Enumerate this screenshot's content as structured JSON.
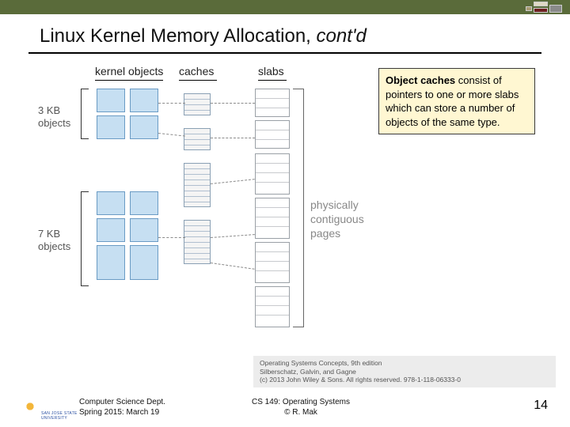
{
  "title": {
    "main": "Linux Kernel Memory Allocation, ",
    "italic": "cont'd"
  },
  "diagram": {
    "headers": {
      "kernel_objects": "kernel objects",
      "caches": "caches",
      "slabs": "slabs"
    },
    "left_labels": {
      "three_kb": "3 KB\nobjects",
      "seven_kb": "7 KB\nobjects"
    },
    "phys_label": "physically\ncontiguous\npages"
  },
  "callout": {
    "bold": "Object caches",
    "rest": " consist of pointers to one or more slabs which can store a number of objects of the same type."
  },
  "reference": {
    "line1": "Operating Systems Concepts, 9th edition",
    "line2": "Silberschatz, Galvin, and Gagne",
    "line3": "(c) 2013 John Wiley & Sons. All rights reserved. 978-1-118-06333-0"
  },
  "footer": {
    "logo_text": "SAN JOSE STATE\nUNIVERSITY",
    "left_line1": "Computer Science Dept.",
    "left_line2": "Spring 2015: March 19",
    "center_line1": "CS 149: Operating Systems",
    "center_line2": "© R. Mak",
    "page": "14"
  }
}
